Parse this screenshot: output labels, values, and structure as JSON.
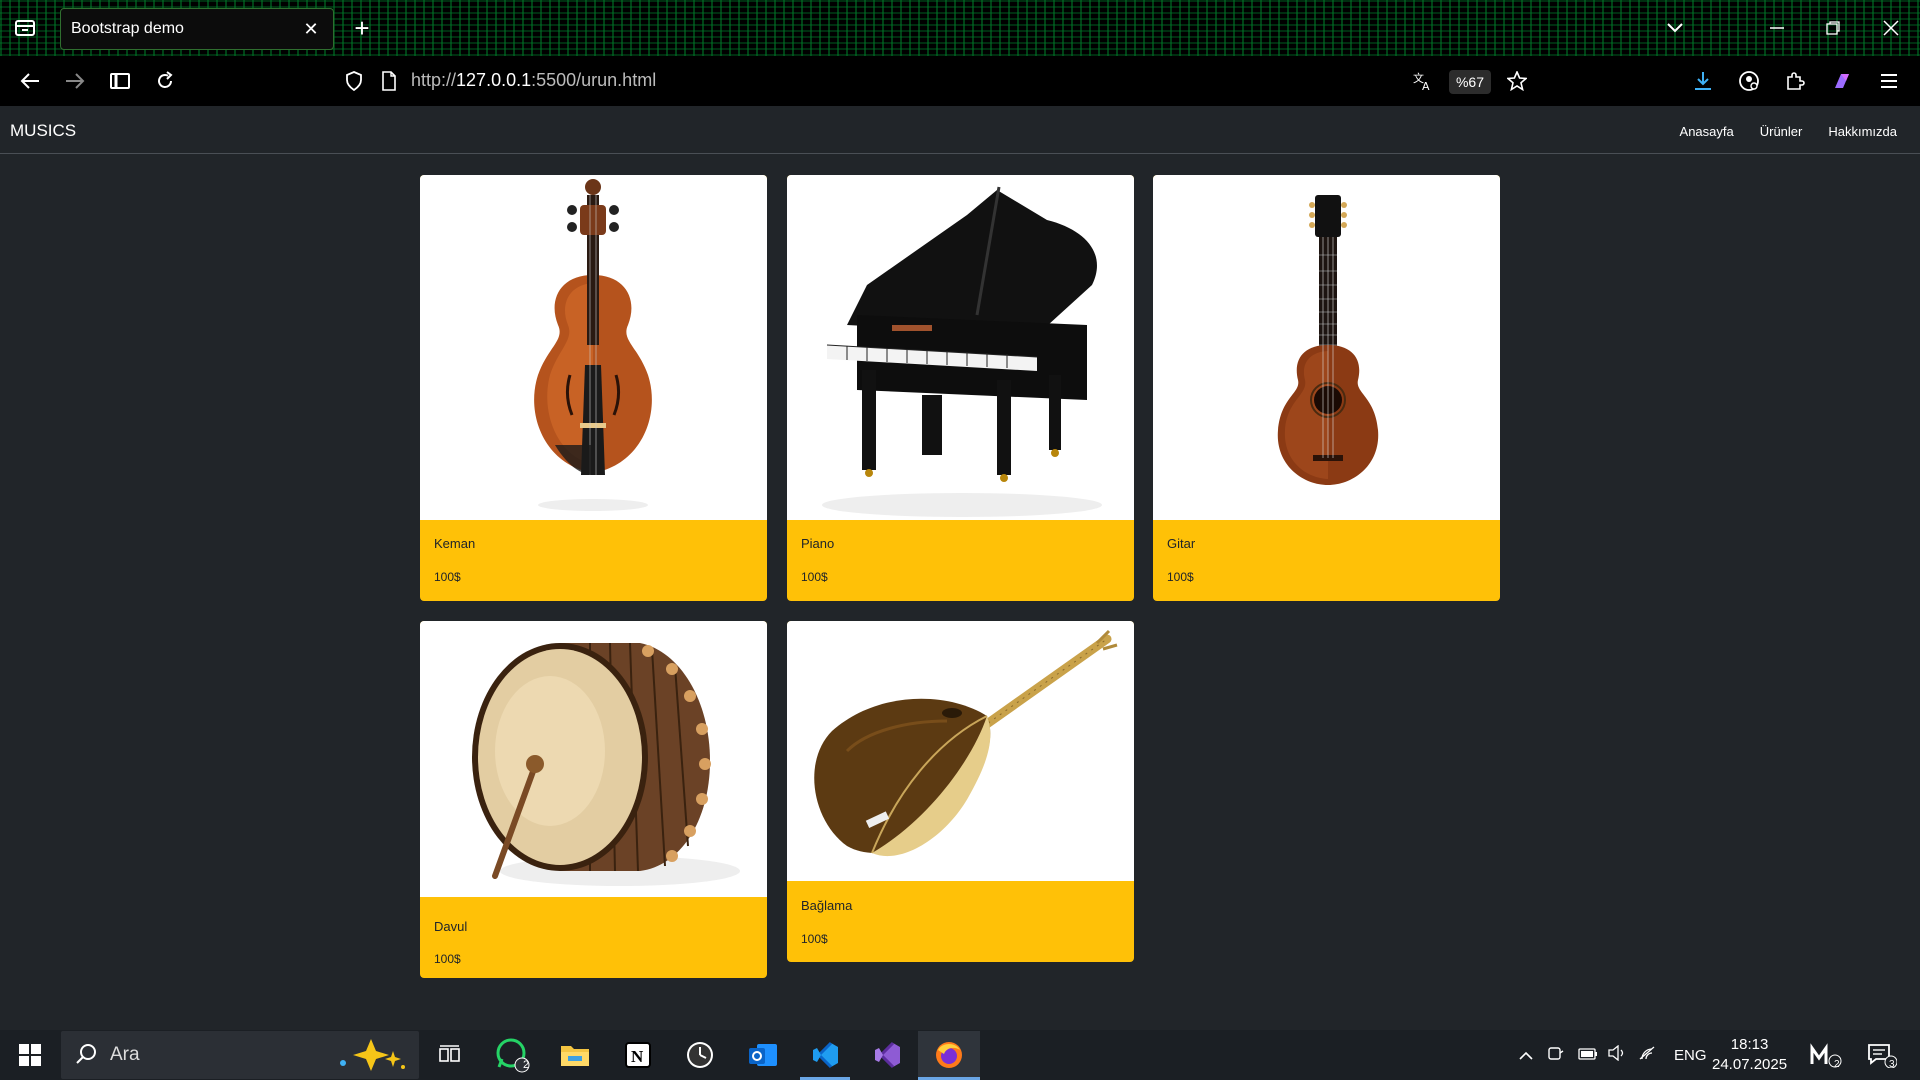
{
  "browser": {
    "tab_title": "Bootstrap demo",
    "url_prefix": "http://",
    "url_host": "127.0.0.1",
    "url_rest": ":5500/urun.html",
    "zoom": "%67"
  },
  "site": {
    "brand": "MUSICS",
    "nav": [
      "Anasayfa",
      "Ürünler",
      "Hakkımızda"
    ]
  },
  "products": [
    {
      "name": "Keman",
      "price": "100$"
    },
    {
      "name": "Piano",
      "price": "100$"
    },
    {
      "name": "Gitar",
      "price": "100$"
    },
    {
      "name": "Davul",
      "price": "100$"
    },
    {
      "name": "Bağlama",
      "price": "100$"
    }
  ],
  "taskbar": {
    "search_placeholder": "Ara",
    "whatsapp_badge": "2",
    "language": "ENG",
    "time": "18:13",
    "date": "24.07.2025",
    "notification_count": "3",
    "widget_badge": "2"
  },
  "colors": {
    "page_bg": "#212529",
    "card_footer": "#ffc107"
  }
}
